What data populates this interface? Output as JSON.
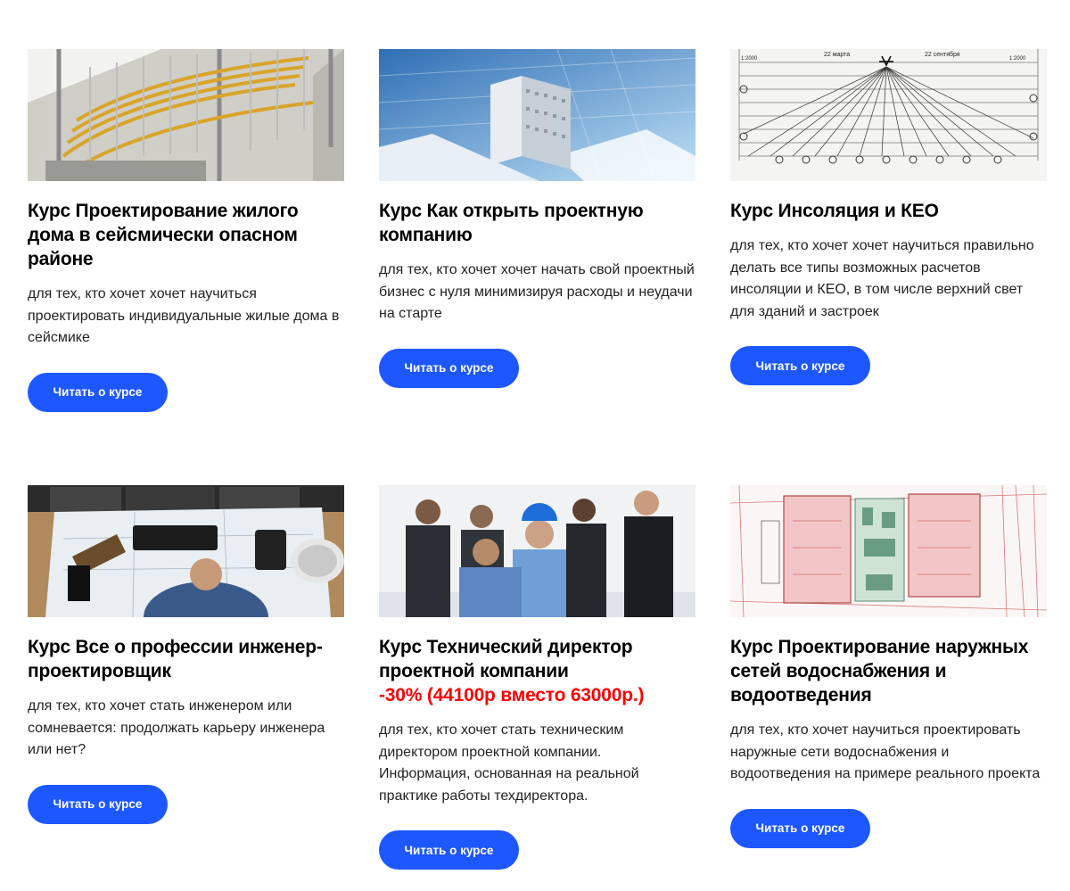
{
  "accent_color": "#1d57ff",
  "promo_color": "#ff0000",
  "courses": [
    {
      "title": "Курс Проектирование жилого дома в сейсмически опасном районе",
      "promo": "",
      "description": "для тех, кто хочет хочет научиться проектировать индивидуальные жилые дома в сейсмике",
      "button": "Читать о курсе",
      "image": "rebar-cage-image"
    },
    {
      "title": "Курс Как открыть проектную компанию",
      "promo": "",
      "description": "для тех, кто хочет хочет начать свой проектный бизнес с нуля минимизируя расходы и неудачи на старте",
      "button": "Читать о курсе",
      "image": "building-model-image"
    },
    {
      "title": "Курс Инсоляция и КЕО",
      "promo": "",
      "description": "для тех, кто хочет хочет научиться правильно делать все типы возможных расчетов инсоляции и КЕО, в том числе верхний свет для зданий и застроек",
      "button": "Читать о курсе",
      "image": "insolation-chart-image",
      "image_labels": {
        "left": "1:2000",
        "march": "22 марта",
        "september": "22 сентября",
        "right": "1:2000"
      }
    },
    {
      "title": "Курс Все о профессии инженер-проектировщик",
      "promo": "",
      "description": "для тех, кто хочет стать инженером или сомневается: продолжать карьеру инженера или нет?",
      "button": "Читать о курсе",
      "image": "engineer-desk-image"
    },
    {
      "title": "Курс Технический директор проектной компании",
      "promo": "-30% (44100р вместо 63000р.)",
      "description": "для тех, кто хочет стать техническим директором проектной компании. Информация, основанная на реальной практике работы техдиректора.",
      "button": "Читать о курсе",
      "image": "team-meeting-image"
    },
    {
      "title": "Курс Проектирование наружных сетей водоснабжения и водоотведения",
      "promo": "",
      "description": "для тех, кто хочет научиться проектировать наружные сети водоснабжения и водоотведения на примере реального проекта",
      "button": "Читать о курсе",
      "image": "site-plan-image"
    }
  ]
}
